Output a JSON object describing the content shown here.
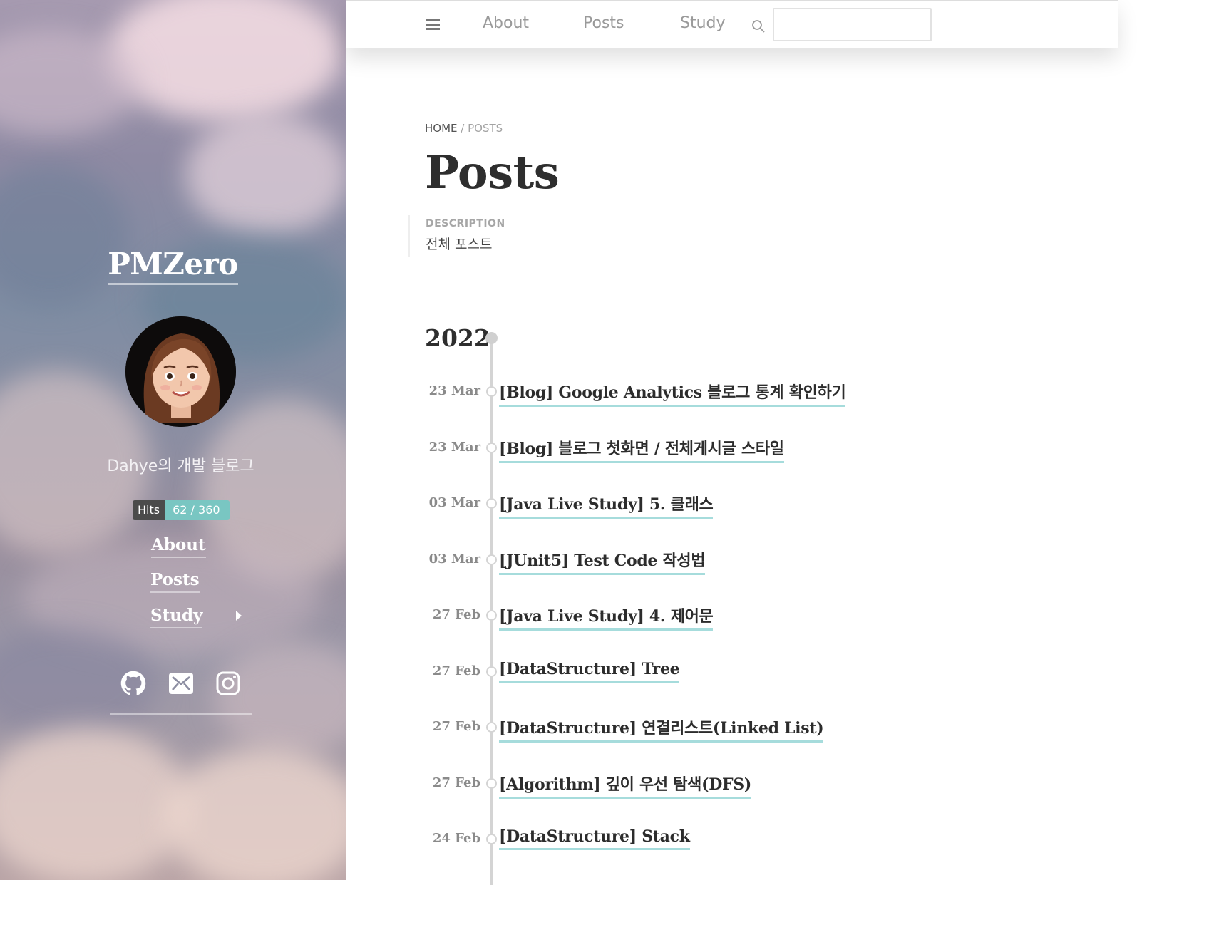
{
  "sidebar": {
    "site_title": "PMZero",
    "description": "Dahye의 개발 블로그",
    "hits_label": "Hits",
    "hits_value": "62 / 360",
    "nav": [
      {
        "label": "About"
      },
      {
        "label": "Posts"
      },
      {
        "label": "Study"
      }
    ],
    "social_icons": [
      "github-icon",
      "mail-icon",
      "instagram-icon"
    ]
  },
  "topnav": {
    "menu_icon": "hamburger-icon",
    "links": [
      {
        "label": "About"
      },
      {
        "label": "Posts"
      },
      {
        "label": "Study"
      }
    ],
    "search_icon": "search-icon",
    "search_value": ""
  },
  "breadcrumb": {
    "home": "HOME",
    "separator": "/",
    "current": "POSTS"
  },
  "page": {
    "title": "Posts",
    "description_label": "DESCRIPTION",
    "description": "전체 포스트"
  },
  "timeline": {
    "year": "2022",
    "posts": [
      {
        "date": "23 Mar",
        "title": "[Blog] Google Analytics 블로그 통계 확인하기"
      },
      {
        "date": "23 Mar",
        "title": "[Blog] 블로그 첫화면 / 전체게시글 스타일"
      },
      {
        "date": "03 Mar",
        "title": "[Java Live Study] 5. 클래스"
      },
      {
        "date": "03 Mar",
        "title": "[JUnit5] Test Code 작성법"
      },
      {
        "date": "27 Feb",
        "title": "[Java Live Study] 4. 제어문"
      },
      {
        "date": "27 Feb",
        "title": "[DataStructure] Tree"
      },
      {
        "date": "27 Feb",
        "title": "[DataStructure] 연결리스트(Linked List)"
      },
      {
        "date": "27 Feb",
        "title": "[Algorithm] 깊이 우선 탐색(DFS)"
      },
      {
        "date": "24 Feb",
        "title": "[DataStructure] Stack"
      }
    ]
  },
  "colors": {
    "accent_underline": "#a6dcdc",
    "hits_badge": "#79c6c2",
    "timeline": "#d4d4d4"
  }
}
